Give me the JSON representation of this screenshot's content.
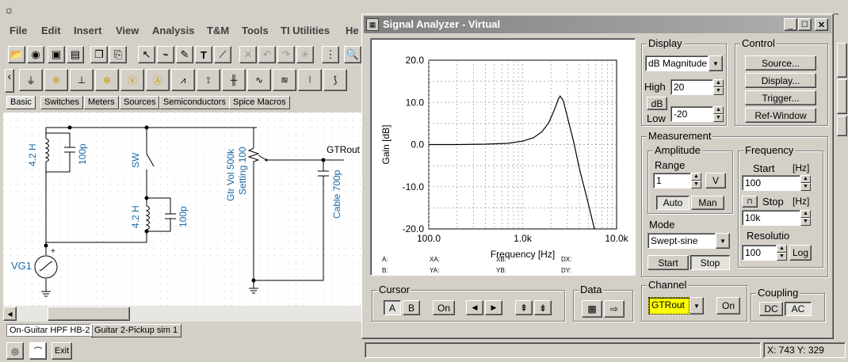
{
  "menu": [
    "File",
    "Edit",
    "Insert",
    "View",
    "Analysis",
    "T&M",
    "Tools",
    "TI Utilities",
    "He"
  ],
  "tabs": [
    "Basic",
    "Switches",
    "Meters",
    "Sources",
    "Semiconductors",
    "Spice Macros"
  ],
  "schematic": {
    "labels": {
      "l1": "4.2 H",
      "c1": "100p",
      "sw": "SW",
      "l2": "4.2 H",
      "c2": "100p",
      "pot1": "Gtr Vol 500k",
      "pot2": "Setting 100",
      "cable": "Cable 700p",
      "out": "GTRout",
      "vg": "VG1"
    }
  },
  "sheet_tabs": [
    "On-Guitar HPF HB-2",
    "Guitar 2-Pickup sim 1"
  ],
  "status": {
    "exit": "Exit",
    "coords": "X: 743  Y: 329"
  },
  "window": {
    "title": "Signal Analyzer - Virtual",
    "display": {
      "title": "Display",
      "mode": "dB Magnitude",
      "high_label": "High",
      "high_value": "20",
      "unit_button": "dB",
      "low_label": "Low",
      "low_value": "-20"
    },
    "control": {
      "title": "Control",
      "buttons": [
        "Source...",
        "Display...",
        "Trigger...",
        "Ref-Window"
      ]
    },
    "measurement": {
      "title": "Measurement",
      "amplitude": {
        "title": "Amplitude",
        "range_label": "Range",
        "range_value": "1",
        "unit_button": "V",
        "auto": "Auto",
        "man": "Man"
      },
      "frequency": {
        "title": "Frequency",
        "start_label": "Start",
        "start_unit": "[Hz]",
        "start_value": "100",
        "stop_label": "Stop",
        "stop_unit": "[Hz]",
        "stop_value": "10k",
        "resolution_label": "Resolutio",
        "resolution_value": "100",
        "log_button": "Log"
      },
      "mode": {
        "title": "Mode",
        "value": "Swept-sine",
        "start_button": "Start",
        "stop_button": "Stop"
      }
    },
    "cursor": {
      "title": "Cursor",
      "a": "A",
      "b": "B",
      "on": "On",
      "left": "◀",
      "right": "▶",
      "up": "⇞",
      "down": "⇟"
    },
    "data": {
      "title": "Data"
    },
    "channel": {
      "title": "Channel",
      "value": "GTRout",
      "on": "On"
    },
    "coupling": {
      "title": "Coupling",
      "dc": "DC",
      "ac": "AC"
    },
    "readout": {
      "a": "A:",
      "b": "B:",
      "xa": "XA:",
      "ya": "YA:",
      "xb": "XB:",
      "yb": "YB:",
      "dx": "DX:",
      "dy": "DY:"
    }
  },
  "chart_data": {
    "type": "line",
    "xlabel": "Frequency [Hz]",
    "ylabel": "Gain [dB]",
    "xscale": "log",
    "xlim": [
      100,
      10000
    ],
    "ylim": [
      -20,
      20
    ],
    "xticks": [
      "100.0",
      "1.0k",
      "10.0k"
    ],
    "yticks": [
      "20.0",
      "10.0",
      "0.0",
      "-10.0",
      "-20.0"
    ],
    "grid": true,
    "series": [
      {
        "color": "#000000",
        "x": [
          100,
          200,
          400,
          700,
          1000,
          1300,
          1600,
          1900,
          2200,
          2400,
          2500,
          2700,
          3000,
          3500,
          4000,
          5000,
          5800
        ],
        "y": [
          0,
          0,
          0.1,
          0.3,
          0.8,
          1.6,
          3.0,
          5.2,
          8.5,
          10.8,
          11.5,
          10.5,
          6.5,
          0.5,
          -5.5,
          -14,
          -20
        ]
      }
    ]
  }
}
